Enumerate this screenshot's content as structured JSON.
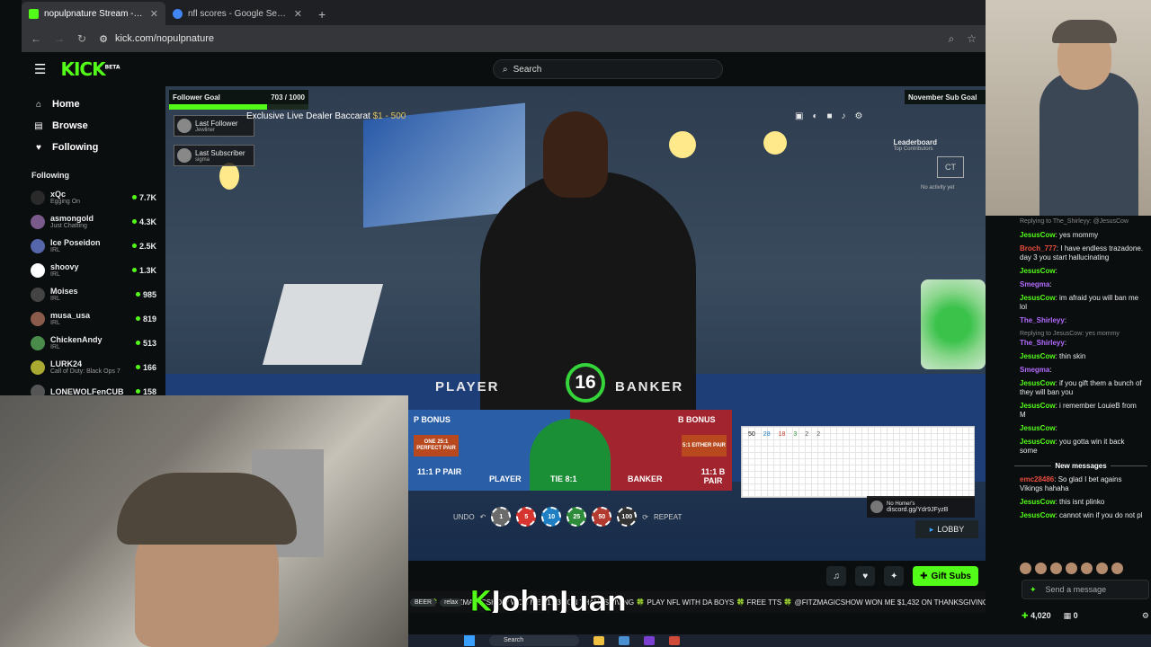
{
  "browser": {
    "tabs": [
      {
        "title": "nopulpnature Stream - Watch Live",
        "favicon_color": "#53fc18",
        "active": true
      },
      {
        "title": "nfl scores - Google Search",
        "favicon_color": "#4285f4",
        "active": false
      }
    ],
    "url": "kick.com/nopulpnature"
  },
  "kick": {
    "logo": "KICK",
    "logo_badge": "BETA",
    "search_placeholder": "Search"
  },
  "sidebar": {
    "nav": [
      {
        "label": "Home",
        "icon": "home-icon",
        "glyph": "⌂"
      },
      {
        "label": "Browse",
        "icon": "browse-icon",
        "glyph": "▤"
      },
      {
        "label": "Following",
        "icon": "heart-icon",
        "glyph": "♥"
      }
    ],
    "following_title": "Following",
    "following": [
      {
        "name": "xQc",
        "category": "Egging On",
        "viewers": "7.7K",
        "color": "#2a2a2a"
      },
      {
        "name": "asmongold",
        "category": "Just Chatting",
        "viewers": "4.3K",
        "color": "#7a5a8a"
      },
      {
        "name": "Ice Poseidon",
        "category": "IRL",
        "viewers": "2.5K",
        "color": "#5566aa"
      },
      {
        "name": "shoovy",
        "category": "IRL",
        "viewers": "1.3K",
        "color": "#ffffff"
      },
      {
        "name": "Moises",
        "category": "IRL",
        "viewers": "985",
        "color": "#444444"
      },
      {
        "name": "musa_usa",
        "category": "IRL",
        "viewers": "819",
        "color": "#8a5a4a"
      },
      {
        "name": "ChickenAndy",
        "category": "IRL",
        "viewers": "513",
        "color": "#4a8a4a"
      },
      {
        "name": "LURK24",
        "category": "Call of Duty: Black Ops 7",
        "viewers": "166",
        "color": "#aaaa33"
      },
      {
        "name": "LONEWOLFenCUB",
        "category": "",
        "viewers": "158",
        "color": "#555555"
      }
    ]
  },
  "stream": {
    "follower_goal_label": "Follower Goal",
    "follower_goal_value": "703 / 1000",
    "follower_goal_fraction": 0.703,
    "sub_goal_label": "November Sub Goal",
    "last_follower_label": "Last Follower",
    "last_follower_name": "Jewliner",
    "last_subscriber_label": "Last Subscriber",
    "last_subscriber_name": "sigma",
    "game_title": "Exclusive Live Dealer Baccarat",
    "game_range": "$1 - 500",
    "leaderboard_title": "Leaderboard",
    "leaderboard_sub": "Top Contributors",
    "ct_label": "CT",
    "no_activity": "No activity yet",
    "countdown": "16",
    "player_word": "PLAYER",
    "banker_word": "BANKER",
    "bets": {
      "p_bonus": "P BONUS",
      "b_bonus": "B BONUS",
      "perfect_pair": "ONE 25:1 PERFECT PAIR",
      "either_pair": "5:1 EITHER PAIR",
      "p_pair": "11:1 P PAIR",
      "b_pair": "11:1 B PAIR",
      "player": "PLAYER",
      "tie": "TIE 8:1",
      "banker": "BANKER"
    },
    "stats": [
      "50",
      "28",
      "18",
      "3",
      "2",
      "2"
    ],
    "chips": {
      "undo": "UNDO",
      "repeat": "REPEAT",
      "values": [
        {
          "label": "1",
          "color": "#6b6b6b"
        },
        {
          "label": "5",
          "color": "#d6352f"
        },
        {
          "label": "10",
          "color": "#1e7fc2"
        },
        {
          "label": "25",
          "color": "#2e8b3a"
        },
        {
          "label": "50",
          "color": "#b23a2f"
        },
        {
          "label": "100",
          "color": "#333333"
        }
      ]
    },
    "discord_name": "No Homer's",
    "discord_link": "discord.gg/Ydr9JFyzB",
    "lobby": "LOBBY",
    "gift_subs": "Gift Subs",
    "ticker": "TTS 🍀 @FITZMAGICSHOW WON ME $1,432 ON THANKSGIVING 🍀 PLAY NFL WITH DA BOYS 🍀 FREE TTS 🍀 @FITZMAGICSHOW WON ME $1,432 ON THANKSGIVING",
    "streamer_overlay": "JohnJuan",
    "tags": [
      "BEER",
      "relax"
    ]
  },
  "chat": {
    "messages": [
      {
        "reply": "Replying to The_Shirleyy: @JesusCow",
        "user": "",
        "text": "",
        "color": "#53fc18"
      },
      {
        "user": "JesusCow",
        "text": "yes mommy",
        "color": "#53fc18"
      },
      {
        "user": "Broch_777",
        "text": "I have endless trazadone. day 3 you start hallucinating",
        "color": "#e74c3c"
      },
      {
        "user": "JesusCow",
        "text": "",
        "color": "#53fc18"
      },
      {
        "user": "Smegma",
        "text": "",
        "color": "#b36bff"
      },
      {
        "user": "JesusCow",
        "text": "im afraid you will ban me lol",
        "color": "#53fc18"
      },
      {
        "user": "The_Shirleyy",
        "text": "",
        "color": "#b36bff"
      },
      {
        "reply": "Replying to JesusCow: yes mommy",
        "user": "The_Shirleyy",
        "text": "",
        "color": "#b36bff"
      },
      {
        "user": "JesusCow",
        "text": "thin skin",
        "color": "#53fc18"
      },
      {
        "user": "Smegma",
        "text": "",
        "color": "#b36bff"
      },
      {
        "user": "JesusCow",
        "text": "if you gift them a bunch of they will ban you",
        "color": "#53fc18"
      },
      {
        "user": "JesusCow",
        "text": "i remember LouieB from M",
        "color": "#53fc18"
      },
      {
        "user": "JesusCow",
        "text": "",
        "color": "#53fc18"
      },
      {
        "user": "JesusCow",
        "text": "you gotta win it back some",
        "color": "#53fc18"
      }
    ],
    "new_messages": "New messages",
    "after": [
      {
        "user": "emc28486",
        "text": "So glad I bet agains Vikings hahaha",
        "color": "#e74c3c"
      },
      {
        "user": "JesusCow",
        "text": "this isnt plinko",
        "color": "#53fc18"
      },
      {
        "user": "JesusCow",
        "text": "cannot win if you do not pl",
        "color": "#53fc18"
      }
    ],
    "input_placeholder": "Send a message",
    "points": "4,020",
    "gifts": "0"
  },
  "taskbar": {
    "search": "Search"
  }
}
